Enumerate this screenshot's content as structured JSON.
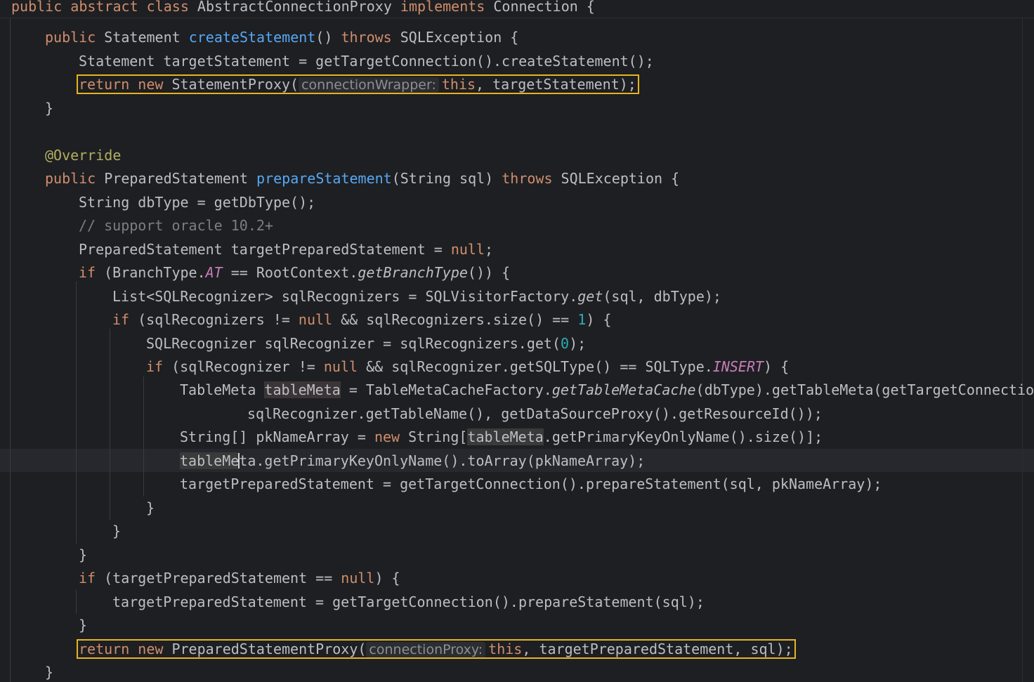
{
  "header": {
    "p1": "public ",
    "p2": "abstract ",
    "p3": "class ",
    "p4": "AbstractConnectionProxy ",
    "p5": "implements ",
    "p6": "Connection {"
  },
  "code": {
    "l1": {
      "a": "public ",
      "b": "Statement ",
      "c": "createStatement",
      "d": "() ",
      "e": "throws ",
      "f": "SQLException {"
    },
    "l2": {
      "a": "Statement targetStatement = getTargetConnection().createStatement();"
    },
    "l3": {
      "a": "return ",
      "b": "new ",
      "c": "StatementProxy(",
      "hint": "connectionWrapper:",
      "d": "this",
      "e": ", targetStatement);"
    },
    "l4": {
      "a": "}"
    },
    "l5": {
      "a": "@Override"
    },
    "l6": {
      "a": "public ",
      "b": "PreparedStatement ",
      "c": "prepareStatement",
      "d": "(String sql) ",
      "e": "throws ",
      "f": "SQLException {"
    },
    "l7": {
      "a": "String dbType = getDbType();"
    },
    "l8": {
      "a": "// support oracle 10.2+"
    },
    "l9": {
      "a": "PreparedStatement targetPreparedStatement = ",
      "b": "null",
      "c": ";"
    },
    "l10": {
      "a": "if ",
      "b": "(BranchType.",
      "c": "AT",
      "d": " == RootContext.",
      "e": "getBranchType",
      "f": "()) {"
    },
    "l11": {
      "a": "List<SQLRecognizer> sqlRecognizers = SQLVisitorFactory.",
      "b": "get",
      "c": "(sql, dbType);"
    },
    "l12": {
      "a": "if ",
      "b": "(sqlRecognizers != ",
      "c": "null",
      "d": " && sqlRecognizers.size() == ",
      "e": "1",
      "f": ") {"
    },
    "l13": {
      "a": "SQLRecognizer sqlRecognizer = sqlRecognizers.get(",
      "b": "0",
      "c": ");"
    },
    "l14": {
      "a": "if ",
      "b": "(sqlRecognizer != ",
      "c": "null",
      "d": " && sqlRecognizer.getSQLType() == SQLType.",
      "e": "INSERT",
      "f": ") {"
    },
    "l15": {
      "a": "TableMeta ",
      "b": "tableMeta",
      "c": " = TableMetaCacheFactory.",
      "d": "getTableMetaCache",
      "e": "(dbType).getTableMeta(getTargetConnection(),"
    },
    "l16": {
      "a": "sqlRecognizer.getTableName(), getDataSourceProxy().getResourceId());"
    },
    "l17": {
      "a": "String[] pkNameArray = ",
      "b": "new ",
      "c": "String[",
      "d": "tableMeta",
      "e": ".getPrimaryKeyOnlyName().size()];"
    },
    "l18": {
      "a": "tableMe",
      "b": "ta.getPrimaryKeyOnlyName().toArray(pkNameArray);"
    },
    "l19": {
      "a": "targetPreparedStatement = getTargetConnection().prepareStatement(sql, pkNameArray);"
    },
    "l20": {
      "a": "}"
    },
    "l21": {
      "a": "}"
    },
    "l22": {
      "a": "}"
    },
    "l23": {
      "a": "if ",
      "b": "(targetPreparedStatement == ",
      "c": "null",
      "d": ") {"
    },
    "l24": {
      "a": "targetPreparedStatement = getTargetConnection().prepareStatement(sql);"
    },
    "l25": {
      "a": "}"
    },
    "l26": {
      "a": "return ",
      "b": "new ",
      "c": "PreparedStatementProxy(",
      "hint": "connectionProxy:",
      "d": "this",
      "e": ", targetPreparedStatement, sql);"
    },
    "l27": {
      "a": "}"
    }
  }
}
